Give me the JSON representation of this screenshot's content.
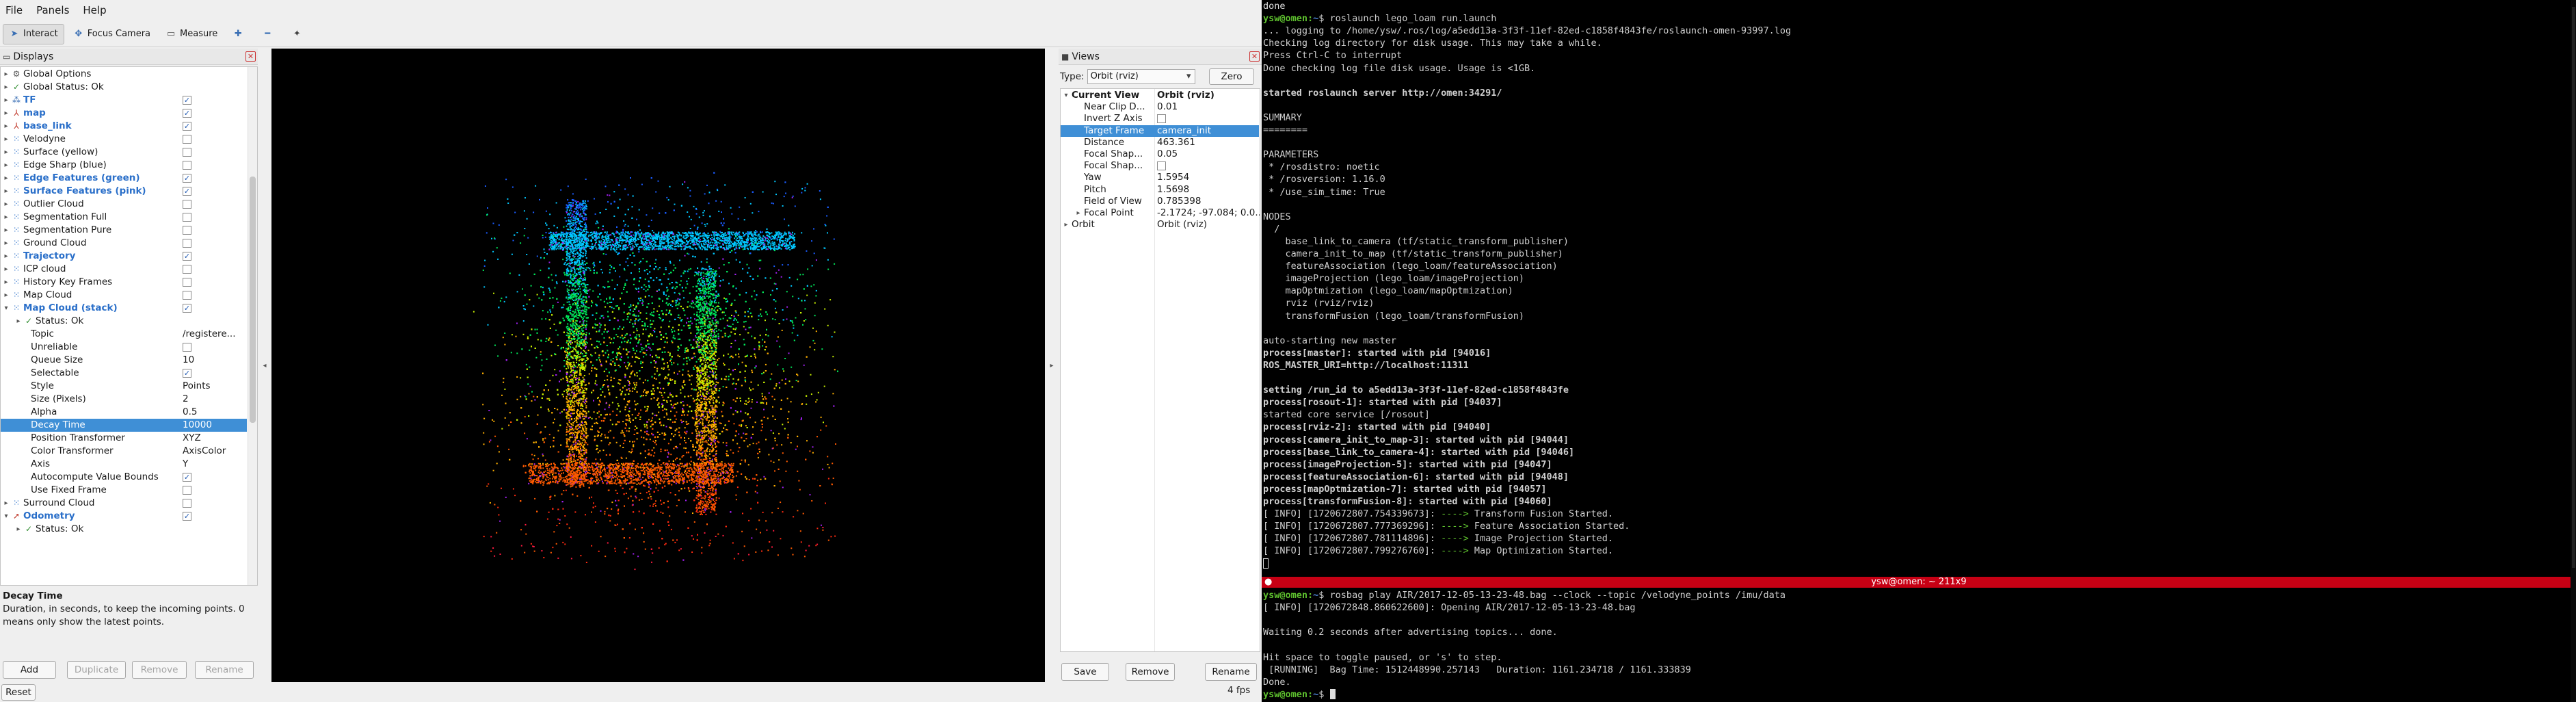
{
  "rviz": {
    "menu": [
      "File",
      "Panels",
      "Help"
    ],
    "toolbar": {
      "interact": "Interact",
      "focus_camera": "Focus Camera",
      "measure": "Measure"
    },
    "displays": {
      "title": "Displays",
      "items": [
        {
          "name": "Global Options",
          "icon": "gear-icon",
          "depth": 0,
          "expandable": true,
          "highlight": false
        },
        {
          "name": "Global Status: Ok",
          "icon": "check-icon",
          "depth": 0,
          "expandable": true,
          "highlight": false
        },
        {
          "name": "TF",
          "icon": "tf-icon",
          "depth": 0,
          "expandable": true,
          "highlight": true,
          "checked": true
        },
        {
          "name": "map",
          "icon": "axes-icon",
          "depth": 0,
          "expandable": true,
          "highlight": true,
          "checked": true
        },
        {
          "name": "base_link",
          "icon": "axes-icon",
          "depth": 0,
          "expandable": true,
          "highlight": true,
          "checked": true
        },
        {
          "name": "Velodyne",
          "icon": "pointcloud-icon",
          "depth": 0,
          "expandable": true,
          "highlight": false,
          "checked": false
        },
        {
          "name": "Surface (yellow)",
          "icon": "pointcloud-icon",
          "depth": 0,
          "expandable": true,
          "highlight": false,
          "checked": false
        },
        {
          "name": "Edge Sharp (blue)",
          "icon": "pointcloud-icon",
          "depth": 0,
          "expandable": true,
          "highlight": false,
          "checked": false
        },
        {
          "name": "Edge Features (green)",
          "icon": "pointcloud-icon",
          "depth": 0,
          "expandable": true,
          "highlight": true,
          "checked": true
        },
        {
          "name": "Surface Features (pink)",
          "icon": "pointcloud-icon",
          "depth": 0,
          "expandable": true,
          "highlight": true,
          "checked": true
        },
        {
          "name": "Outlier Cloud",
          "icon": "pointcloud-icon",
          "depth": 0,
          "expandable": true,
          "highlight": false,
          "checked": false
        },
        {
          "name": "Segmentation Full",
          "icon": "pointcloud-icon",
          "depth": 0,
          "expandable": true,
          "highlight": false,
          "checked": false
        },
        {
          "name": "Segmentation Pure",
          "icon": "pointcloud-icon",
          "depth": 0,
          "expandable": true,
          "highlight": false,
          "checked": false
        },
        {
          "name": "Ground Cloud",
          "icon": "pointcloud-icon",
          "depth": 0,
          "expandable": true,
          "highlight": false,
          "checked": false
        },
        {
          "name": "Trajectory",
          "icon": "pointcloud-icon",
          "depth": 0,
          "expandable": true,
          "highlight": true,
          "checked": true
        },
        {
          "name": "ICP cloud",
          "icon": "pointcloud-icon",
          "depth": 0,
          "expandable": true,
          "highlight": false,
          "checked": false
        },
        {
          "name": "History Key Frames",
          "icon": "pointcloud-icon",
          "depth": 0,
          "expandable": true,
          "highlight": false,
          "checked": false
        },
        {
          "name": "Map Cloud",
          "icon": "pointcloud-icon",
          "depth": 0,
          "expandable": true,
          "highlight": false,
          "checked": false
        },
        {
          "name": "Map Cloud (stack)",
          "icon": "pointcloud-icon",
          "depth": 0,
          "expandable": true,
          "expanded": true,
          "highlight": true,
          "checked": true
        },
        {
          "name": "Status: Ok",
          "icon": "check-icon",
          "depth": 1,
          "expandable": true,
          "highlight": false
        },
        {
          "name": "Topic",
          "depth": 1,
          "value": "/registere..."
        },
        {
          "name": "Unreliable",
          "depth": 1,
          "checked": false
        },
        {
          "name": "Queue Size",
          "depth": 1,
          "value": "10"
        },
        {
          "name": "Selectable",
          "depth": 1,
          "checked": true
        },
        {
          "name": "Style",
          "depth": 1,
          "value": "Points"
        },
        {
          "name": "Size (Pixels)",
          "depth": 1,
          "value": "2"
        },
        {
          "name": "Alpha",
          "depth": 1,
          "value": "0.5"
        },
        {
          "name": "Decay Time",
          "depth": 1,
          "value": "10000",
          "selected": true
        },
        {
          "name": "Position Transformer",
          "depth": 1,
          "value": "XYZ"
        },
        {
          "name": "Color Transformer",
          "depth": 1,
          "value": "AxisColor"
        },
        {
          "name": "Axis",
          "depth": 1,
          "value": "Y"
        },
        {
          "name": "Autocompute Value Bounds",
          "depth": 1,
          "checked": true
        },
        {
          "name": "Use Fixed Frame",
          "depth": 1,
          "checked": false
        },
        {
          "name": "Surround Cloud",
          "icon": "pointcloud-icon",
          "depth": 0,
          "expandable": true,
          "highlight": false,
          "checked": false
        },
        {
          "name": "Odometry",
          "icon": "odometry-icon",
          "depth": 0,
          "expandable": true,
          "expanded": true,
          "highlight": true,
          "checked": true
        },
        {
          "name": "Status: Ok",
          "icon": "check-icon",
          "depth": 1,
          "expandable": true,
          "highlight": false
        }
      ],
      "description_title": "Decay Time",
      "description_text": "Duration, in seconds, to keep the incoming points. 0 means only show the latest points.",
      "buttons": {
        "add": "Add",
        "duplicate": "Duplicate",
        "remove": "Remove",
        "rename": "Rename"
      },
      "reset": "Reset"
    },
    "views": {
      "title": "Views",
      "type_label": "Type:",
      "type_value": "Orbit (rviz)",
      "zero": "Zero",
      "items": [
        {
          "name": "Current View",
          "value": "Orbit (rviz)",
          "depth": 0,
          "bold": true,
          "expanded": true
        },
        {
          "name": "Near Clip D...",
          "value": "0.01",
          "depth": 1
        },
        {
          "name": "Invert Z Axis",
          "value": "",
          "depth": 1,
          "checkbox": true
        },
        {
          "name": "Target Frame",
          "value": "camera_init",
          "depth": 1,
          "selected": true
        },
        {
          "name": "Distance",
          "value": "463.361",
          "depth": 1
        },
        {
          "name": "Focal Shap...",
          "value": "0.05",
          "depth": 1
        },
        {
          "name": "Focal Shap...",
          "value": "",
          "depth": 1,
          "checkbox": true
        },
        {
          "name": "Yaw",
          "value": "1.5954",
          "depth": 1
        },
        {
          "name": "Pitch",
          "value": "1.5698",
          "depth": 1
        },
        {
          "name": "Field of View",
          "value": "0.785398",
          "depth": 1
        },
        {
          "name": "Focal Point",
          "value": "-2.1724; -97.084; 0.0...",
          "depth": 1,
          "expandable": true
        },
        {
          "name": "Orbit",
          "value": "Orbit (rviz)",
          "depth": 0,
          "expandable": true
        }
      ],
      "buttons": {
        "save": "Save",
        "remove": "Remove",
        "rename": "Rename"
      }
    },
    "fps": "4 fps"
  },
  "terminal": {
    "top_lines": [
      {
        "t": "done",
        "c": "gr"
      },
      {
        "prompt": "ysw@omen",
        "path": "~",
        "cmd": "$ roslaunch lego_loam run.launch"
      },
      {
        "t": "... logging to /home/ysw/.ros/log/a5edd13a-3f3f-11ef-82ed-c1858f4843fe/roslaunch-omen-93997.log",
        "c": ""
      },
      {
        "t": "Checking log directory for disk usage. This may take a while.",
        "c": ""
      },
      {
        "t": "Press Ctrl-C to interrupt",
        "c": ""
      },
      {
        "t": "Done checking log file disk usage. Usage is <1GB.",
        "c": ""
      },
      {
        "t": "",
        "c": ""
      },
      {
        "t": "started roslaunch server http://omen:34291/",
        "c": "b"
      },
      {
        "t": "",
        "c": ""
      },
      {
        "t": "SUMMARY",
        "c": ""
      },
      {
        "t": "========",
        "c": ""
      },
      {
        "t": "",
        "c": ""
      },
      {
        "t": "PARAMETERS",
        "c": ""
      },
      {
        "t": " * /rosdistro: noetic",
        "c": ""
      },
      {
        "t": " * /rosversion: 1.16.0",
        "c": ""
      },
      {
        "t": " * /use_sim_time: True",
        "c": ""
      },
      {
        "t": "",
        "c": ""
      },
      {
        "t": "NODES",
        "c": ""
      },
      {
        "t": "  /",
        "c": ""
      },
      {
        "t": "    base_link_to_camera (tf/static_transform_publisher)",
        "c": ""
      },
      {
        "t": "    camera_init_to_map (tf/static_transform_publisher)",
        "c": ""
      },
      {
        "t": "    featureAssociation (lego_loam/featureAssociation)",
        "c": ""
      },
      {
        "t": "    imageProjection (lego_loam/imageProjection)",
        "c": ""
      },
      {
        "t": "    mapOptmization (lego_loam/mapOptmization)",
        "c": ""
      },
      {
        "t": "    rviz (rviz/rviz)",
        "c": ""
      },
      {
        "t": "    transformFusion (lego_loam/transformFusion)",
        "c": ""
      },
      {
        "t": "",
        "c": ""
      },
      {
        "t": "auto-starting new master",
        "c": ""
      },
      {
        "t": "process[master]: started with pid [94016]",
        "c": "b"
      },
      {
        "t": "ROS_MASTER_URI=http://localhost:11311",
        "c": "b"
      },
      {
        "t": "",
        "c": ""
      },
      {
        "t": "setting /run_id to a5edd13a-3f3f-11ef-82ed-c1858f4843fe",
        "c": "b"
      },
      {
        "t": "process[rosout-1]: started with pid [94037]",
        "c": "b"
      },
      {
        "t": "started core service [/rosout]",
        "c": ""
      },
      {
        "t": "process[rviz-2]: started with pid [94040]",
        "c": "b"
      },
      {
        "t": "process[camera_init_to_map-3]: started with pid [94044]",
        "c": "b"
      },
      {
        "t": "process[base_link_to_camera-4]: started with pid [94046]",
        "c": "b"
      },
      {
        "t": "process[imageProjection-5]: started with pid [94047]",
        "c": "b"
      },
      {
        "t": "process[featureAssociation-6]: started with pid [94048]",
        "c": "b"
      },
      {
        "t": "process[mapOptmization-7]: started with pid [94057]",
        "c": "b"
      },
      {
        "t": "process[transformFusion-8]: started with pid [94060]",
        "c": "b"
      },
      {
        "t": "[ INFO] [1720672807.754339673]: \u001b[32m---->\u001b[0m Transform Fusion Started.",
        "c": ""
      },
      {
        "t": "[ INFO] [1720672807.777369296]: \u001b[32m---->\u001b[0m Feature Association Started.",
        "c": ""
      },
      {
        "t": "[ INFO] [1720672807.781114896]: \u001b[32m---->\u001b[0m Image Projection Started.",
        "c": ""
      },
      {
        "t": "[ INFO] [1720672807.799276760]: \u001b[32m---->\u001b[0m Map Optimization Started.",
        "c": ""
      }
    ],
    "divider_title": "ysw@omen: ~ 211x9",
    "bottom_lines": [
      {
        "prompt": "ysw@omen",
        "path": "~",
        "cmd": "$ rosbag play AIR/2017-12-05-13-23-48.bag --clock --topic /velodyne_points /imu/data"
      },
      {
        "t": "[ INFO] [1720672848.860622600]: Opening AIR/2017-12-05-13-23-48.bag",
        "c": ""
      },
      {
        "t": "",
        "c": ""
      },
      {
        "t": "Waiting 0.2 seconds after advertising topics... done.",
        "c": ""
      },
      {
        "t": "",
        "c": ""
      },
      {
        "t": "Hit space to toggle paused, or 's' to step.",
        "c": ""
      },
      {
        "t": " [RUNNING]  Bag Time: 1512448990.257143   Duration: 1161.234718 / 1161.333839",
        "c": ""
      },
      {
        "t": "Done.",
        "c": ""
      }
    ],
    "final_prompt": {
      "prompt": "ysw@omen",
      "path": "~",
      "cmd": "$ "
    },
    "colors": {
      "prompt": "#5ec12e",
      "path": "#4f85d7",
      "divider": "#c70014"
    }
  }
}
